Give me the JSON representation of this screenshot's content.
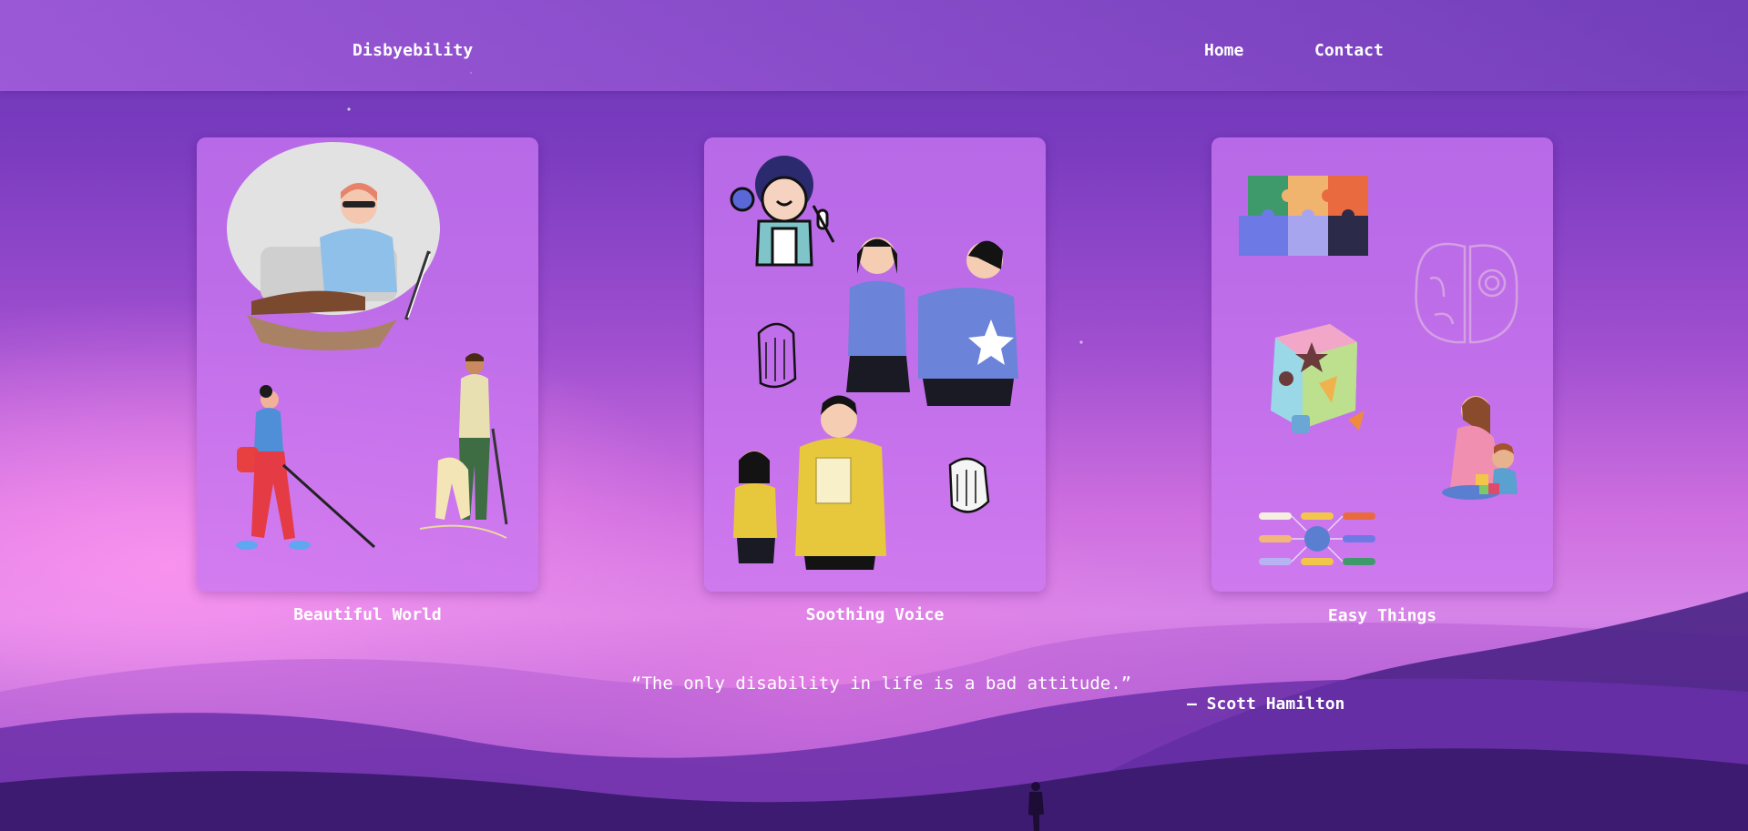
{
  "header": {
    "brand": "Disbyebility",
    "nav": [
      "Home",
      "Contact"
    ]
  },
  "cards": [
    {
      "caption": "Beautiful World"
    },
    {
      "caption": "Soothing Voice"
    },
    {
      "caption": "Easy Things"
    }
  ],
  "quote": {
    "text": "“The only disability in life is a bad attitude.”",
    "author": "— Scott Hamilton"
  },
  "colors": {
    "header": "#8e55cc",
    "card": "#c47ae8",
    "text": "#ffffff",
    "dunes_dark": "#3a1a6e"
  }
}
